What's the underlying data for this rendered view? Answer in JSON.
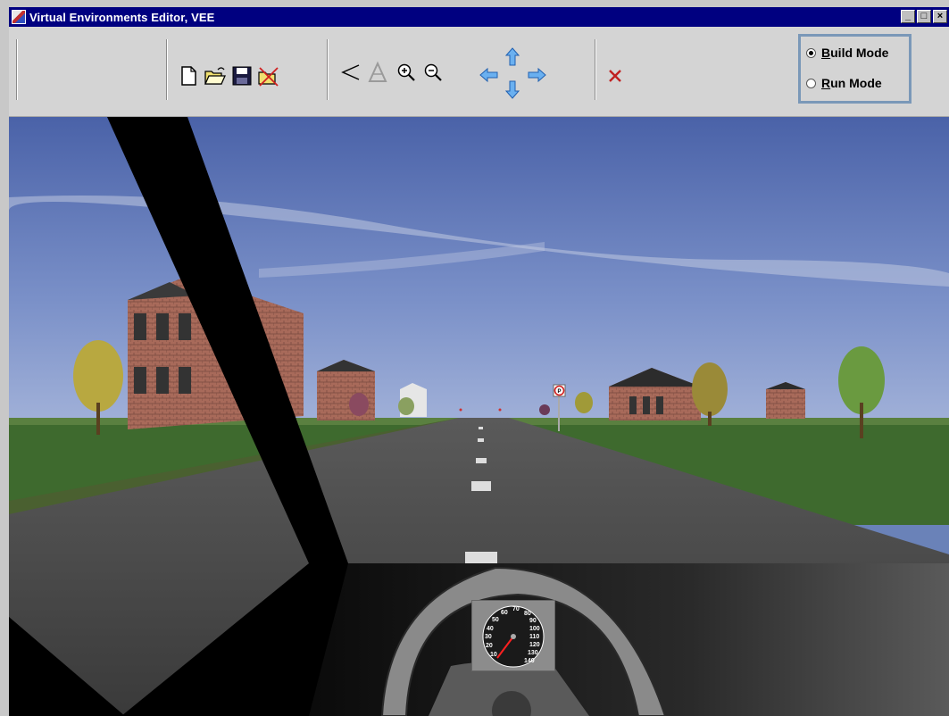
{
  "window": {
    "title": "Virtual Environments Editor, VEE",
    "controls": [
      "minimize",
      "maximize",
      "close"
    ]
  },
  "toolbar": {
    "file_icons": [
      "new-file-icon",
      "open-folder-icon",
      "save-disk-icon",
      "close-file-icon"
    ],
    "view_icons": [
      "select-angle-icon",
      "triangle-a-icon",
      "zoom-in-icon",
      "zoom-out-icon",
      "arrow-left-icon",
      "arrow-up-icon",
      "arrow-down-icon",
      "arrow-right-icon"
    ],
    "delete_icon": "red-x-icon"
  },
  "mode": {
    "build_prefix": "B",
    "build_rest": "uild Mode",
    "run_prefix": "R",
    "run_rest": "un Mode",
    "selected": "build"
  },
  "scene": {
    "speedometer_ticks": [
      "10",
      "20",
      "30",
      "40",
      "50",
      "60",
      "70",
      "80",
      "90",
      "100",
      "110",
      "120",
      "130",
      "140"
    ],
    "sign_label": "P"
  },
  "colors": {
    "title_bar": "#000080",
    "toolbar": "#d4d4d4",
    "sky": "#6a82b8",
    "grass": "#3e6a2e",
    "road": "#4a4a4a"
  }
}
